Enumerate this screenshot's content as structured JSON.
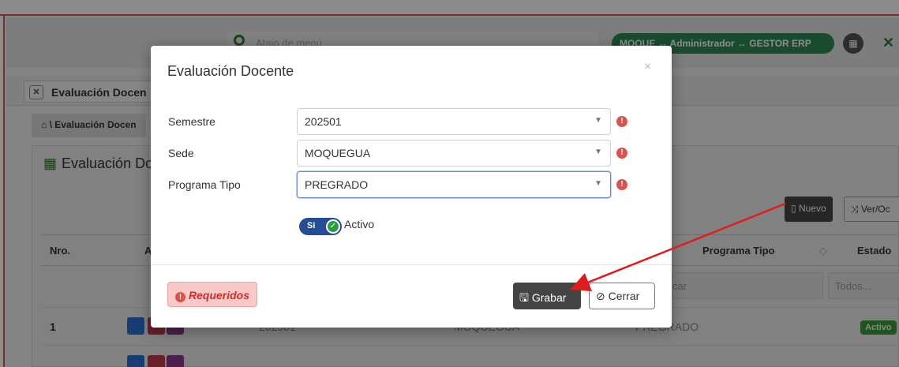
{
  "header": {
    "search_placeholder": "Atajo de menú",
    "user_context": "MOQUE ↔ Administrador ↔ GESTOR ERP",
    "apps_icon": "apps-grid-icon",
    "expand_icon": "expand-icon"
  },
  "tabs": [
    {
      "label": "Evaluación Docen"
    }
  ],
  "breadcrumb": "\\ Evaluación Docen",
  "panel": {
    "title": "Evaluación Do",
    "new_label": "Nuevo",
    "toggle_columns_label": "Ver/Oc"
  },
  "table": {
    "columns": [
      "Nro.",
      "A",
      "Programa Tipo",
      "Estado"
    ],
    "filters": {
      "search_placeholder": "car",
      "estado_value": "Todos..."
    },
    "rows": [
      {
        "nro": "1",
        "semestre": "202501",
        "sede": "MOQUEGUA",
        "programa": "PREGRADO",
        "estado": "Activo"
      }
    ]
  },
  "modal": {
    "title": "Evaluación Docente",
    "fields": [
      {
        "label": "Semestre",
        "value": "202501"
      },
      {
        "label": "Sede",
        "value": "MOQUEGUA"
      },
      {
        "label": "Programa Tipo",
        "value": "PREGRADO"
      }
    ],
    "toggle": {
      "state_label": "Si",
      "label": "Activo",
      "on": true
    },
    "required_label": "Requeridos",
    "save_label": "Grabar",
    "close_label": "Cerrar"
  },
  "colors": {
    "accent_green": "#2e8b57",
    "danger": "#d9534f",
    "toggle_blue": "#274c96",
    "annotation_arrow": "#e01b1b"
  }
}
